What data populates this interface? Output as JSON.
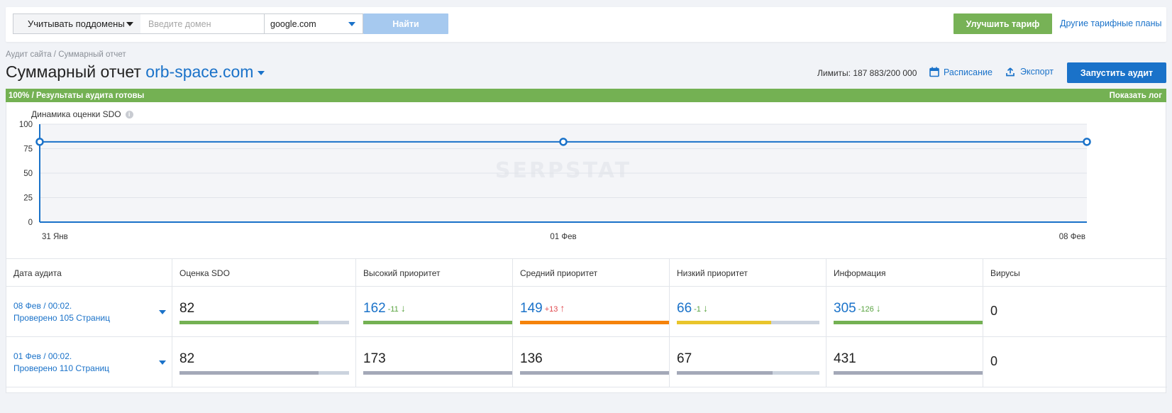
{
  "topbar": {
    "subdomains_label": "Учитывать поддомены",
    "domain_placeholder": "Введите домен",
    "engine_value": "google.com",
    "find_label": "Найти",
    "upgrade_label": "Улучшить тариф",
    "plans_label": "Другие тарифные планы"
  },
  "breadcrumb": "Аудит сайта / Суммарный отчет",
  "title": {
    "prefix": "Суммарный отчет",
    "domain": "orb-space.com"
  },
  "actions": {
    "limits": "Лимиты: 187 883/200 000",
    "schedule": "Расписание",
    "export": "Экспорт",
    "run": "Запустить аудит"
  },
  "progress": {
    "status": "100% / Результаты аудита готовы",
    "show_log": "Показать лог"
  },
  "watermark": "SERPSTAT",
  "chart_data": {
    "type": "line",
    "title": "Динамика оценки SDO",
    "x": [
      "31 Янв",
      "01 Фев",
      "08 Фев"
    ],
    "series": [
      {
        "values": [
          82,
          82,
          82
        ]
      }
    ],
    "yticks": [
      0,
      25,
      50,
      75,
      100
    ],
    "ylim": [
      0,
      100
    ],
    "grid": true
  },
  "table": {
    "headers": [
      "Дата аудита",
      "Оценка SDO",
      "Высокий приоритет",
      "Средний приоритет",
      "Низкий приоритет",
      "Информация",
      "Вирусы"
    ],
    "rows": [
      {
        "date": "08 Фев / 00:02.",
        "pages": "Проверено 105 Страниц",
        "sdo": "82",
        "sdo_pct": 82,
        "high": "162",
        "high_delta": "-11",
        "high_dir": "↓",
        "high_color": "green",
        "high_pct": 100,
        "high_fill": "#74b153",
        "medium": "149",
        "medium_delta": "+13",
        "medium_dir": "↑",
        "medium_color": "red",
        "medium_pct": 100,
        "medium_fill": "#f5830b",
        "low": "66",
        "low_delta": "-1",
        "low_dir": "↓",
        "low_color": "green",
        "low_pct": 66,
        "low_fill": "#e9c52b",
        "info": "305",
        "info_delta": "-126",
        "info_dir": "↓",
        "info_color": "green",
        "info_pct": 100,
        "info_fill": "#74b153",
        "viruses": "0"
      },
      {
        "date": "01 Фев / 00:02.",
        "pages": "Проверено 110 Страниц",
        "sdo": "82",
        "sdo_pct": 82,
        "high": "173",
        "high_pct": 100,
        "medium": "136",
        "medium_pct": 100,
        "low": "67",
        "low_pct": 67,
        "info": "431",
        "info_pct": 100,
        "viruses": "0"
      }
    ]
  },
  "colors": {
    "accent": "#1a72c9",
    "green": "#74b153",
    "orange": "#f5830b",
    "yellow": "#e9c52b",
    "grey_bar": "#a4a9b8",
    "track": "#cbd3de"
  }
}
